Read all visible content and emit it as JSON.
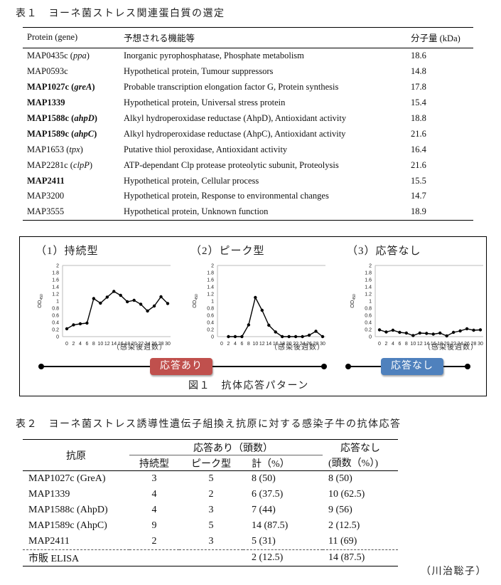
{
  "table1": {
    "caption": "表１　ヨーネ菌ストレス関連蛋白質の選定",
    "headers": [
      "Protein (gene)",
      "予想される機能等",
      "分子量 (kDa)"
    ],
    "rows": [
      {
        "id": "MAP0435c",
        "gene": "ppa",
        "function": "Inorganic pyrophosphatase, Phosphate metabolism",
        "mw": "18.6",
        "bold": false
      },
      {
        "id": "MAP0593c",
        "gene": "",
        "function": "Hypothetical protein, Tumour suppressors",
        "mw": "14.8",
        "bold": false
      },
      {
        "id": "MAP1027c",
        "gene": "greA",
        "function": "Probable transcription elongation factor G, Protein synthesis",
        "mw": "17.8",
        "bold": true
      },
      {
        "id": "MAP1339",
        "gene": "",
        "function": "Hypothetical protein, Universal stress protein",
        "mw": "15.4",
        "bold": true
      },
      {
        "id": "MAP1588c",
        "gene": "ahpD",
        "function": "Alkyl hydroperoxidase reductase (AhpD), Antioxidant activity",
        "mw": "18.8",
        "bold": true
      },
      {
        "id": "MAP1589c",
        "gene": "ahpC",
        "function": "Alkyl hydroperoxidase reductase (AhpC), Antioxidant activity",
        "mw": "21.6",
        "bold": true
      },
      {
        "id": "MAP1653",
        "gene": "tpx",
        "function": "Putative thiol peroxidase, Antioxidant activity",
        "mw": "16.4",
        "bold": false
      },
      {
        "id": "MAP2281c",
        "gene": "clpP",
        "function": "ATP-dependant Clp protease proteolytic subunit, Proteolysis",
        "mw": "21.6",
        "bold": false
      },
      {
        "id": "MAP2411",
        "gene": "",
        "function": "Hypothetical protein, Cellular process",
        "mw": "15.5",
        "bold": true
      },
      {
        "id": "MAP3200",
        "gene": "",
        "function": "Hypothetical protein, Response to environmental changes",
        "mw": "14.7",
        "bold": false
      },
      {
        "id": "MAP3555",
        "gene": "",
        "function": "Hypothetical protein, Unknown function",
        "mw": "18.9",
        "bold": false
      }
    ]
  },
  "figure1": {
    "caption": "図１　抗体応答パターン",
    "response_yes_label": "応答あり",
    "response_no_label": "応答なし",
    "colors": {
      "response_yes": "#c0504d",
      "response_no": "#4f81bd"
    }
  },
  "chart_data": [
    {
      "type": "line",
      "title": "（1）持続型",
      "xlabel": "（感染後週数）",
      "ylabel": "OD450",
      "ylim": [
        0,
        2
      ],
      "yticks": [
        "0",
        "0.2",
        "0.4",
        "0.6",
        "0.8",
        "1",
        "1.2",
        "1.4",
        "1.6",
        "1.8",
        "2"
      ],
      "x": [
        0,
        2,
        4,
        6,
        8,
        10,
        12,
        14,
        16,
        18,
        20,
        22,
        24,
        26,
        28,
        30
      ],
      "x_tick_labels": [
        "0",
        "2",
        "4",
        "6",
        "8",
        "10",
        "12",
        "14",
        "16",
        "18",
        "20",
        "22",
        "24",
        "26",
        "28",
        "30"
      ],
      "values": [
        0.22,
        0.33,
        0.36,
        0.38,
        1.07,
        0.94,
        1.11,
        1.27,
        1.16,
        0.98,
        1.02,
        0.91,
        0.72,
        0.86,
        1.12,
        0.93
      ],
      "grid": false
    },
    {
      "type": "line",
      "title": "（2）ピーク型",
      "xlabel": "（感染後週数）",
      "ylabel": "OD450",
      "ylim": [
        0,
        2
      ],
      "yticks": [
        "0",
        "0.2",
        "0.4",
        "0.6",
        "0.8",
        "1",
        "1.2",
        "1.4",
        "1.6",
        "1.8",
        "2"
      ],
      "x": [
        2,
        4,
        6,
        8,
        10,
        12,
        14,
        16,
        18,
        20,
        22,
        24,
        26,
        28,
        30
      ],
      "x_tick_labels": [
        "0",
        "2",
        "4",
        "6",
        "8",
        "10",
        "12",
        "14",
        "16",
        "18",
        "20",
        "22",
        "24",
        "26",
        "28",
        "30"
      ],
      "values": [
        0,
        0,
        0,
        0.33,
        1.1,
        0.74,
        0.32,
        0.13,
        0,
        0,
        0,
        0,
        0.04,
        0.15,
        0
      ],
      "grid": false
    },
    {
      "type": "line",
      "title": "（3）応答なし",
      "xlabel": "（感染後週数）",
      "ylabel": "OD450",
      "ylim": [
        0,
        2
      ],
      "yticks": [
        "0",
        "0.2",
        "0.4",
        "0.6",
        "0.8",
        "1",
        "1.2",
        "1.4",
        "1.6",
        "1.8",
        "2"
      ],
      "x": [
        0,
        2,
        4,
        6,
        8,
        10,
        12,
        14,
        16,
        18,
        20,
        22,
        24,
        26,
        28,
        30
      ],
      "x_tick_labels": [
        "0",
        "2",
        "4",
        "6",
        "8",
        "10",
        "12",
        "14",
        "16",
        "18",
        "20",
        "22",
        "24",
        "26",
        "28",
        "30"
      ],
      "values": [
        0.19,
        0.13,
        0.18,
        0.12,
        0.1,
        0.03,
        0.1,
        0.09,
        0.07,
        0.1,
        0.02,
        0.12,
        0.16,
        0.22,
        0.18,
        0.19
      ],
      "grid": false
    }
  ],
  "table2": {
    "caption": "表２　ヨーネ菌ストレス誘導性遺伝子組換え抗原に対する感染子牛の抗体応答",
    "header": {
      "antigen": "抗原",
      "response_yes": "応答あり（頭数）",
      "sustained": "持続型",
      "peak": "ピーク型",
      "total": "計（%）",
      "response_no_line1": "応答なし",
      "response_no_line2": "(頭数（%）)"
    },
    "rows": [
      {
        "antigen": "MAP1027c (GreA)",
        "sustained": "3",
        "peak": "5",
        "total": "8 (50)",
        "none": "8 (50)"
      },
      {
        "antigen": "MAP1339",
        "sustained": "4",
        "peak": "2",
        "total": "6 (37.5)",
        "none": "10 (62.5)"
      },
      {
        "antigen": "MAP1588c (AhpD)",
        "sustained": "4",
        "peak": "3",
        "total": "7 (44)",
        "none": "9 (56)"
      },
      {
        "antigen": "MAP1589c (AhpC)",
        "sustained": "9",
        "peak": "5",
        "total": "14 (87.5)",
        "none": "2 (12.5)"
      },
      {
        "antigen": "MAP2411",
        "sustained": "2",
        "peak": "3",
        "total": "5 (31)",
        "none": "11 (69)"
      }
    ],
    "elisa_row": {
      "antigen": "市販 ELISA",
      "sustained": "",
      "peak": "",
      "total": "2 (12.5)",
      "none": "14 (87.5)"
    }
  },
  "author": "（川治聡子）"
}
